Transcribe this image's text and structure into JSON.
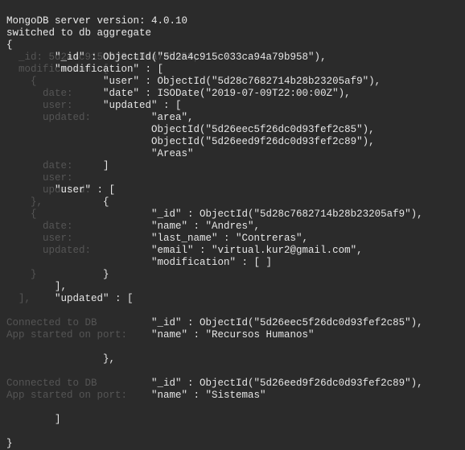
{
  "ghost": {
    "l1": "MongoDB server version: 4.0.10",
    "l2": "switched to db aggregate",
    "l3": "{",
    "l4": "  _id: 5d2a4c915c033ca94a79b958,",
    "l5": "  modification: [",
    "l6": "    {",
    "l7": "      date:",
    "l8": "      user:",
    "l9": "      updated:",
    "l10": "",
    "l11": "",
    "l12": "",
    "l13": "      date:",
    "l14": "      user:",
    "l15": "      updated:",
    "l16": "    },",
    "l17": "    {",
    "l18": "      date:",
    "l19": "      user:",
    "l20": "      updated:",
    "l21": "",
    "l22": "    }",
    "l23": "",
    "l24": "  ],",
    "l25": "",
    "l26": "Connected to DB",
    "l27": "App started on port:",
    "l28": "",
    "l29": "",
    "l30": "",
    "l31": "Connected to DB",
    "l32": "App started on port:",
    "l33": "",
    "l34": "",
    "l35": "",
    "l36": "}"
  },
  "front": {
    "l1": "MongoDB server version: 4.0.10",
    "l2": "switched to db aggregate",
    "l3": "{",
    "l4": "        \"_id\" : ObjectId(\"5d2a4c915c033ca94a79b958\"),",
    "l5": "        \"modification\" : [",
    "l6": "                \"user\" : ObjectId(\"5d28c7682714b28b23205af9\"),",
    "l7": "                \"date\" : ISODate(\"2019-07-09T22:00:00Z\"),",
    "l8": "                \"updated\" : [",
    "l9": "                        \"area\",",
    "l10": "                        ObjectId(\"5d26eec5f26dc0d93fef2c85\"),",
    "l11": "                        ObjectId(\"5d26eed9f26dc0d93fef2c89\"),",
    "l12": "                        \"Areas\"",
    "l13": "                ]",
    "l14": "",
    "l15": "        \"user\" : [",
    "l16": "                {",
    "l17": "                        \"_id\" : ObjectId(\"5d28c7682714b28b23205af9\"),",
    "l18": "                        \"name\" : \"Andres\",",
    "l19": "                        \"last_name\" : \"Contreras\",",
    "l20": "                        \"email\" : \"virtual.kur2@gmail.com\",",
    "l21": "                        \"modification\" : [ ]",
    "l22": "                }",
    "l23": "        ],",
    "l24": "        \"updated\" : [",
    "l25": "",
    "l26": "                        \"_id\" : ObjectId(\"5d26eec5f26dc0d93fef2c85\"),",
    "l27": "                        \"name\" : \"Recursos Humanos\"",
    "l28": "",
    "l29": "                },",
    "l30": "",
    "l31": "                        \"_id\" : ObjectId(\"5d26eed9f26dc0d93fef2c89\"),",
    "l32": "                        \"name\" : \"Sistemas\"",
    "l33": "",
    "l34": "        ]",
    "l35": "",
    "l36": "}"
  }
}
